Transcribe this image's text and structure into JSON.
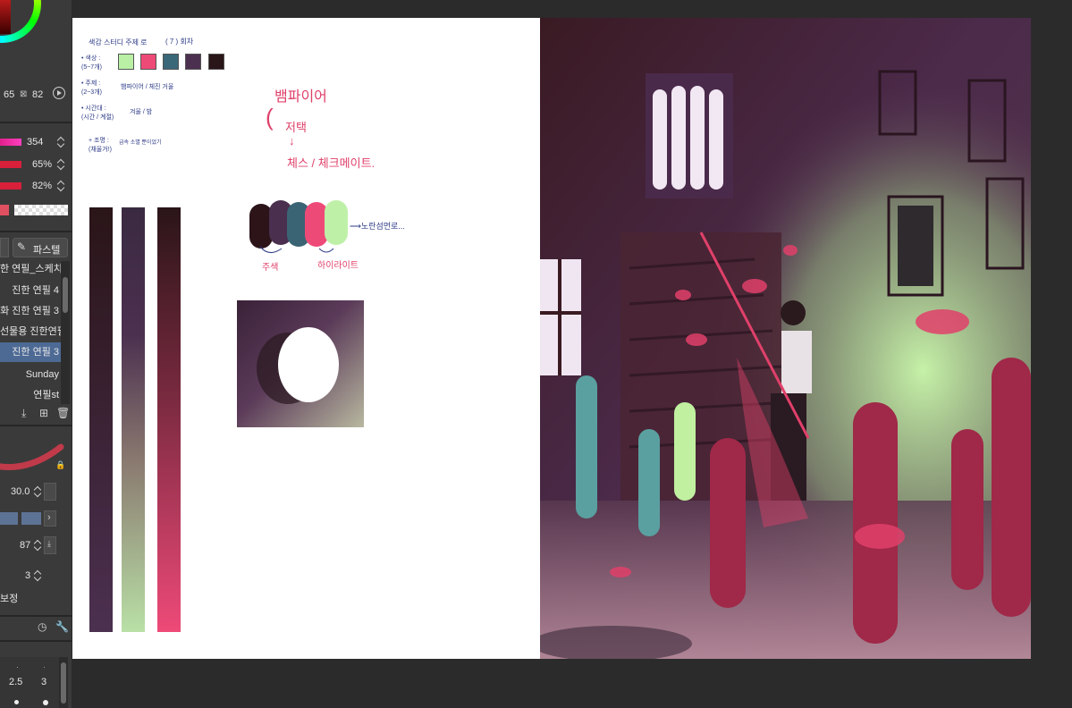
{
  "panel": {
    "color_values": {
      "s": "65",
      "v": "82"
    },
    "sliders": [
      {
        "value": "354"
      },
      {
        "value": "65%"
      },
      {
        "value": "82%"
      }
    ],
    "tool_button": {
      "label": "파스텔"
    },
    "subtools": [
      {
        "label": "한 연필_스케치",
        "selected": false
      },
      {
        "label": "진한 연필 4",
        "selected": false
      },
      {
        "label": "화 진한 연필 3",
        "selected": false
      },
      {
        "label": "선물용 진한연필",
        "selected": false
      },
      {
        "label": "진한 연필 3",
        "selected": true
      },
      {
        "label": "Sunday",
        "selected": false
      },
      {
        "label": "연필st",
        "selected": false
      }
    ],
    "brush_size": "30.0",
    "opacity": "87",
    "level": "3",
    "correction_label": "보정",
    "brush_sizes": [
      "2.5",
      "3"
    ]
  },
  "canvas": {
    "notes": {
      "title": "색감 스터디 주제 로",
      "count": "( 7 ) 회차",
      "color_label": "• 색상 :\n(5~7개)",
      "theme_label": "• 주제 :\n(2~3개)",
      "theme_value": "뱀파이어 / 체진 거울",
      "time_label": "• 시간대 :\n(시간 / 계절)",
      "time_value": "겨울 / 밤",
      "extra_label": "+ 조명 :\n(채울거!)",
      "extra_value": "급속 소멸 뿐이었기",
      "idea_1": "뱀파이어",
      "idea_2": "저택",
      "idea_3": "↓",
      "idea_4": "체스 / 체크메이트.",
      "main_label": "주색",
      "highlight_label": "하이라이트",
      "arrow_note": "⟶노란섬먼로..."
    },
    "palette": [
      "#b9f0a6",
      "#ee4a78",
      "#3a6878",
      "#4c3050",
      "#2a1518"
    ],
    "blobs": [
      "#2c1418",
      "#4a2f4e",
      "#3a6474",
      "#ee4a78",
      "#bff0a8"
    ]
  }
}
